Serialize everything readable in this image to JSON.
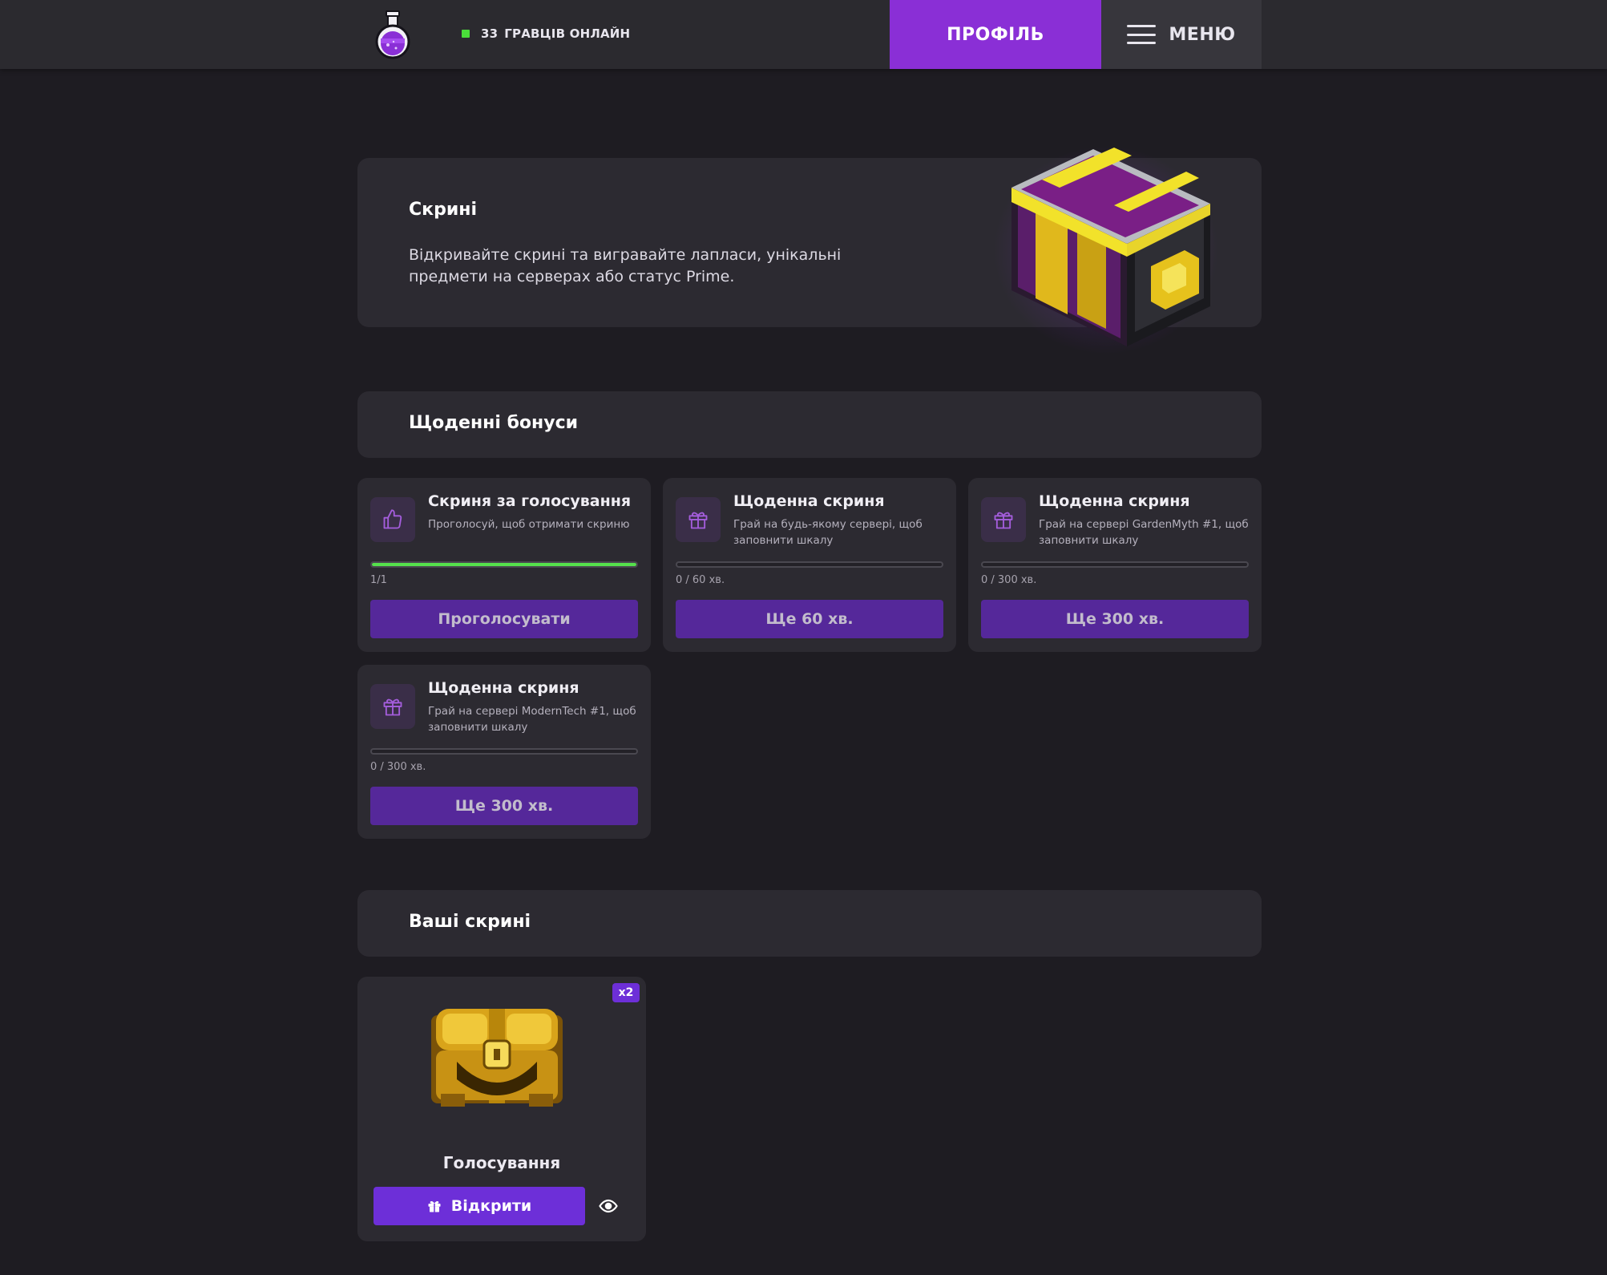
{
  "header": {
    "online_count": "33",
    "online_text": "ГРАВЦІВ ОНЛАЙН",
    "profile_label": "ПРОФІЛЬ",
    "menu_label": "МЕНЮ",
    "accent_color": "#8a2fd6",
    "online_color": "#4ade3a"
  },
  "hero": {
    "title": "Скрині",
    "description": "Відкривайте скрині та вигравайте лапласи, унікальні предмети на серверах або статус Prime."
  },
  "daily": {
    "title": "Щоденні бонуси",
    "cards": [
      {
        "icon": "thumbs-up-icon",
        "title": "Скриня за голосування",
        "desc": "Проголосуй, щоб отримати скриню",
        "progress": 1.0,
        "progress_text": "1/1",
        "button": "Проголосувати"
      },
      {
        "icon": "gift-icon",
        "title": "Щоденна скриня",
        "desc": "Грай на будь-якому сервері, щоб заповнити шкалу",
        "progress": 0,
        "progress_text": "0 / 60 хв.",
        "button": "Ще 60 хв."
      },
      {
        "icon": "gift-icon",
        "title": "Щоденна скриня",
        "desc": "Грай на сервері GardenMyth #1, щоб заповнити шкалу",
        "progress": 0,
        "progress_text": "0 / 300 хв.",
        "button": "Ще 300 хв."
      },
      {
        "icon": "gift-icon",
        "title": "Щоденна скриня",
        "desc": "Грай на сервері ModernTech #1, щоб заповнити шкалу",
        "progress": 0,
        "progress_text": "0 / 300 хв.",
        "button": "Ще 300 хв."
      }
    ]
  },
  "your_chests": {
    "title": "Ваші скрині",
    "items": [
      {
        "badge": "x2",
        "name": "Голосування",
        "open_label": "Відкрити",
        "icons": [
          "gift-icon",
          "eye-icon"
        ]
      }
    ]
  }
}
